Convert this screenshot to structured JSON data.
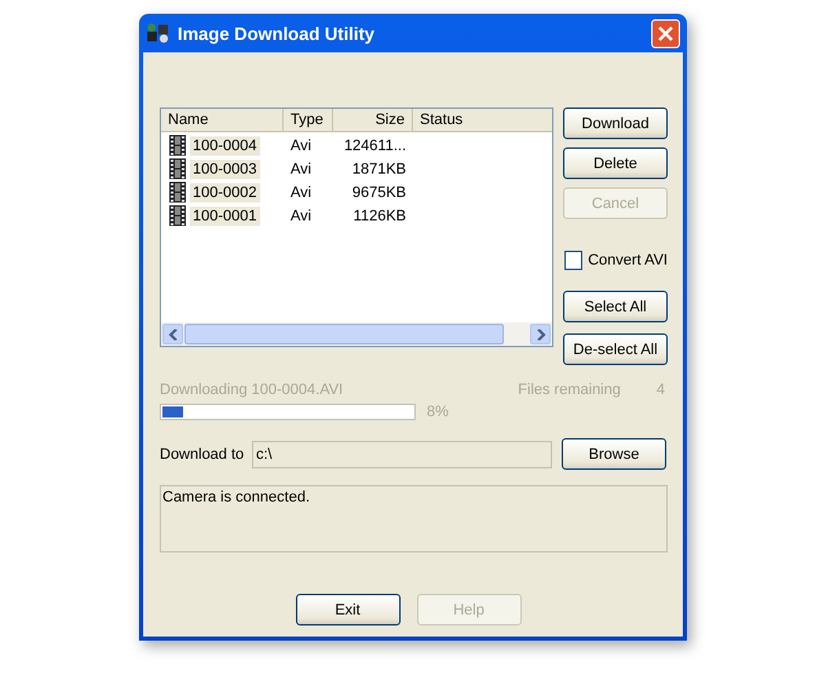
{
  "window": {
    "title": "Image Download Utility"
  },
  "file_list": {
    "columns": [
      "Name",
      "Type",
      "Size",
      "Status"
    ],
    "rows": [
      {
        "name": "100-0004",
        "type": "Avi",
        "size": "124611...",
        "selected": true
      },
      {
        "name": "100-0003",
        "type": "Avi",
        "size": "1871KB",
        "selected": true
      },
      {
        "name": "100-0002",
        "type": "Avi",
        "size": "9675KB",
        "selected": true
      },
      {
        "name": "100-0001",
        "type": "Avi",
        "size": "1126KB",
        "selected": true
      }
    ]
  },
  "side_buttons": [
    {
      "kind": "button",
      "label": "Download",
      "disabled": false
    },
    {
      "kind": "button",
      "label": "Delete",
      "disabled": false
    },
    {
      "kind": "button",
      "label": "Cancel",
      "disabled": true
    },
    {
      "kind": "checkbox",
      "label": "Convert AVI",
      "checked": false
    },
    {
      "kind": "button",
      "label": "Select All",
      "disabled": false
    },
    {
      "kind": "button",
      "label": "De-select All",
      "disabled": false
    }
  ],
  "progress": {
    "label": "Downloading 100-0004.AVI",
    "remaining_label": "Files remaining",
    "remaining": "4",
    "level": 0.08,
    "percent": "8%",
    "disabled": true
  },
  "destination": {
    "label": "Download to",
    "value": "c:\\",
    "button": "Browse"
  },
  "status_message": "Camera is connected.",
  "bottom_buttons": [
    {
      "label": "Exit",
      "disabled": false
    },
    {
      "label": "Help",
      "disabled": true
    }
  ]
}
